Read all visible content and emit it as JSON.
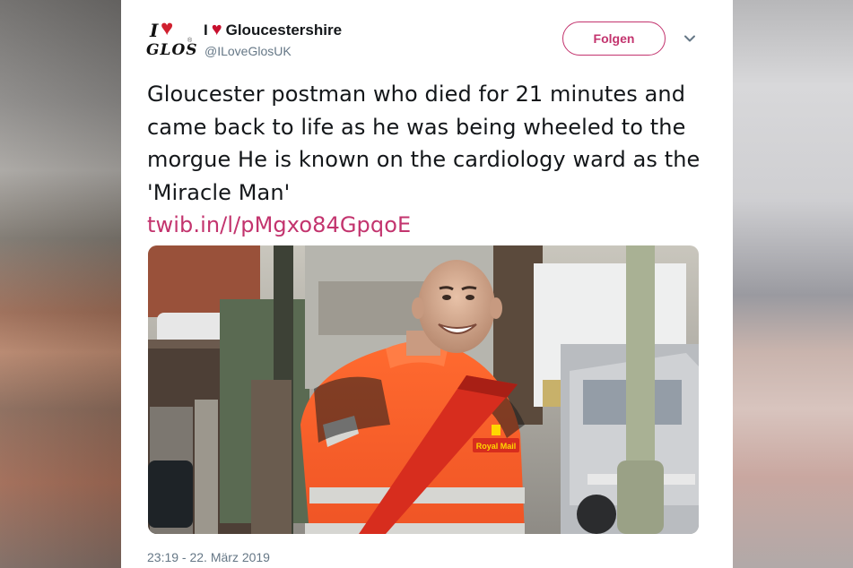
{
  "account": {
    "logo_text_i": "I",
    "logo_text_glos": "GLOS",
    "name_prefix": "I",
    "name_suffix": "Gloucestershire",
    "handle": "@ILoveGlosUK"
  },
  "follow_label": "Folgen",
  "tweet": {
    "text": "Gloucester postman who died for 21 minutes and came back to life as he was being wheeled to the morgue He is known on the cardiology ward as the 'Miracle Man'",
    "link": "twib.in/l/pMgxo84GpqoE",
    "badge_text": "Royal Mail"
  },
  "timestamp": "23:19 - 22. März 2019",
  "colors": {
    "accent": "#c3346e",
    "heart": "#c8102e",
    "text": "#14171a",
    "secondary": "#657786"
  },
  "icons": {
    "more": "chevron-down-icon",
    "heart": "heart-icon"
  }
}
